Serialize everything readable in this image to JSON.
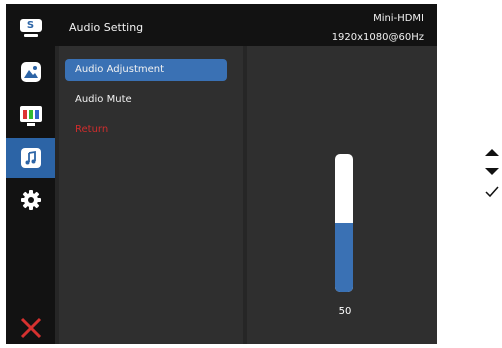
{
  "header": {
    "title": "Audio Setting",
    "source": "Mini-HDMI",
    "resolution": "1920x1080@60Hz"
  },
  "nav": {
    "items": [
      {
        "name": "input-source-icon",
        "label": "S"
      },
      {
        "name": "image-icon"
      },
      {
        "name": "color-icon"
      },
      {
        "name": "audio-icon",
        "active": true
      },
      {
        "name": "settings-icon"
      }
    ],
    "exit_icon": "close-icon"
  },
  "menu": {
    "items": [
      {
        "label": "Audio Adjustment",
        "selected": true
      },
      {
        "label": "Audio Mute"
      },
      {
        "label": "Return",
        "color": "#cf2d2d"
      }
    ]
  },
  "slider": {
    "value": "50",
    "level": 0.5
  },
  "keys": [
    "up-arrow-icon",
    "down-arrow-icon",
    "check-icon"
  ],
  "colors": {
    "accent": "#3a71b4",
    "return": "#cf2d2d",
    "exit": "#d6312f"
  }
}
